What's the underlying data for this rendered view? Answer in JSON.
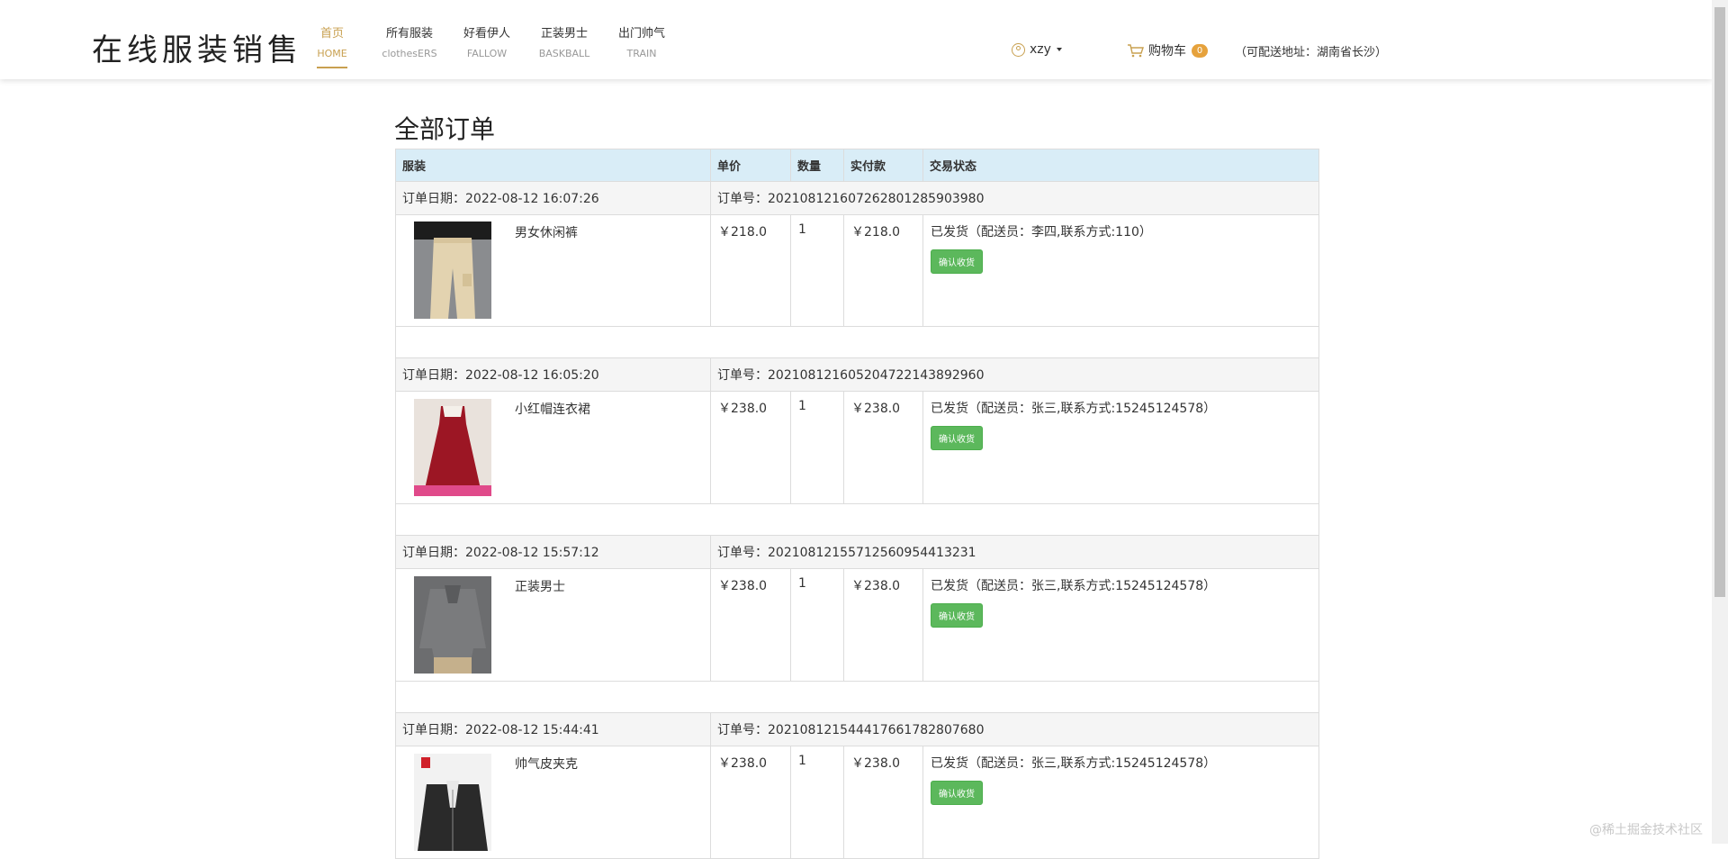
{
  "header": {
    "logo": "在线服装销售",
    "nav": [
      {
        "cn": "首页",
        "en": "HOME",
        "active": true
      },
      {
        "cn": "所有服装",
        "en": "clothesERS"
      },
      {
        "cn": "好看伊人",
        "en": "FALLOW"
      },
      {
        "cn": "正装男士",
        "en": "BASKBALL"
      },
      {
        "cn": "出门帅气",
        "en": "TRAIN"
      }
    ],
    "user": "xzy",
    "cart_label": "购物车",
    "cart_count": "0",
    "address": "（可配送地址：湖南省长沙）"
  },
  "page_title": "全部订单",
  "table_headers": {
    "product": "服装",
    "price": "单价",
    "quantity": "数量",
    "paid": "实付款",
    "status": "交易状态"
  },
  "orders": [
    {
      "date": "订单日期：2022-08-12 16:07:26",
      "order_no": "订单号：202108121607262801285903980",
      "name": "男女休闲裤",
      "price": "￥218.0",
      "qty": "1",
      "paid": "￥218.0",
      "status": "已发货（配送员：李四,联系方式:110）",
      "button": "确认收货"
    },
    {
      "date": "订单日期：2022-08-12 16:05:20",
      "order_no": "订单号：202108121605204722143892960",
      "name": "小红帽连衣裙",
      "price": "￥238.0",
      "qty": "1",
      "paid": "￥238.0",
      "status": "已发货（配送员：张三,联系方式:15245124578）",
      "button": "确认收货"
    },
    {
      "date": "订单日期：2022-08-12 15:57:12",
      "order_no": "订单号：20210812155712560954413231",
      "name": "正装男士",
      "price": "￥238.0",
      "qty": "1",
      "paid": "￥238.0",
      "status": "已发货（配送员：张三,联系方式:15245124578）",
      "button": "确认收货"
    },
    {
      "date": "订单日期：2022-08-12 15:44:41",
      "order_no": "订单号：202108121544417661782807680",
      "name": "帅气皮夹克",
      "price": "￥238.0",
      "qty": "1",
      "paid": "￥238.0",
      "status": "已发货（配送员：张三,联系方式:15245124578）",
      "button": "确认收货"
    }
  ],
  "watermark": "@稀土掘金技术社区",
  "colors": {
    "accent": "#c8a050",
    "header_row": "#d9edf7",
    "button": "#5cb85c"
  }
}
